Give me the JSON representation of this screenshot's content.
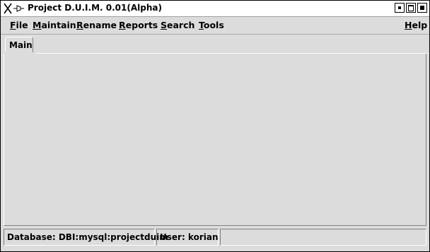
{
  "window": {
    "title": "Project D.U.I.M. 0.01(Alpha)",
    "logo_icon": "x-window-logo-icon"
  },
  "title_buttons": [
    "minimize",
    "maximize",
    "close"
  ],
  "menubar": {
    "items": [
      {
        "label": "File",
        "mnemonic": "F",
        "rest": "ile"
      },
      {
        "label": "Maintain",
        "mnemonic": "M",
        "rest": "aintain"
      },
      {
        "label": "Rename",
        "mnemonic": "R",
        "rest": "ename"
      },
      {
        "label": "Reports",
        "mnemonic": "R",
        "rest": "eports"
      },
      {
        "label": "Search",
        "mnemonic": "S",
        "rest": "earch"
      },
      {
        "label": "Tools",
        "mnemonic": "T",
        "rest": "ools"
      }
    ],
    "help": {
      "label": "Help",
      "mnemonic": "H",
      "rest": "elp"
    }
  },
  "tabs": [
    {
      "label": "Main",
      "active": true
    }
  ],
  "statusbar": {
    "database": "Database:  DBI:mysql:projectduim",
    "user": "User:  korian",
    "extra": ""
  },
  "colors": {
    "background": "#dcdcdc",
    "titlebar": "#ffffff",
    "border_dark": "#808080",
    "border_light": "#ffffff"
  }
}
